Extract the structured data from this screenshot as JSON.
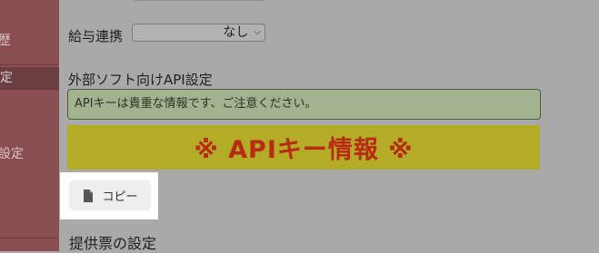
{
  "sidebar": {
    "items": [
      {
        "label": "歴"
      },
      {
        "label": "定"
      },
      {
        "label": "設定"
      }
    ]
  },
  "payroll": {
    "label": "給与連携",
    "select_value": "なし"
  },
  "api_section": {
    "heading": "外部ソフト向けAPI設定",
    "notice": "APIキーは貴重な情報です、ご注意ください。",
    "banner": "※ APIキー情報 ※",
    "copy_label": "コピー",
    "copy_icon": "document-icon"
  },
  "invoice_section": {
    "heading": "提供票の設定"
  }
}
